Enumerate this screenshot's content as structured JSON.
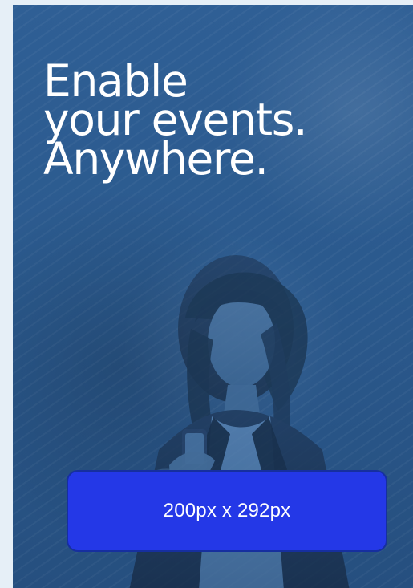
{
  "banner": {
    "headline_lines": [
      "Enable",
      "your events.",
      "Anywhere."
    ],
    "size_label": "200px x 292px"
  },
  "colors": {
    "page_background": "#e6eff7",
    "banner_blue": "#2f5f95",
    "headline_text": "#ffffff",
    "label_box_fill": "#2438e7",
    "label_box_border": "#162f9f",
    "label_text": "#ffffff"
  }
}
